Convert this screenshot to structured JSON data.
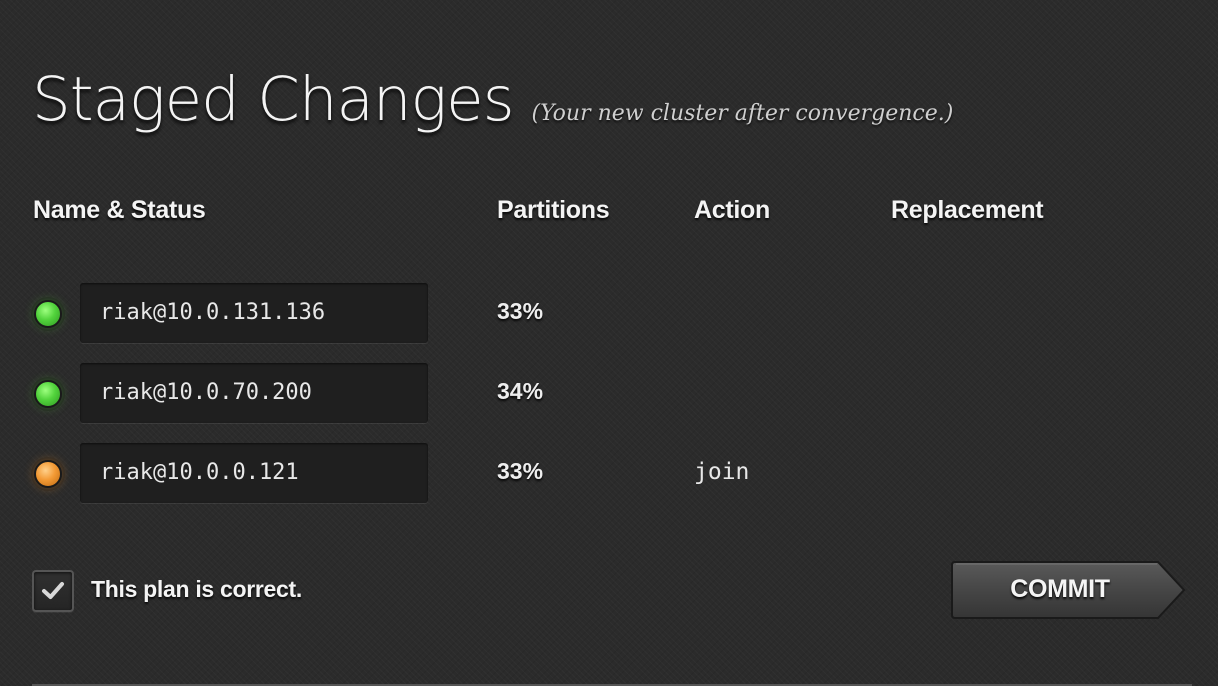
{
  "header": {
    "title": "Staged Changes",
    "subtitle": "(Your new cluster after convergence.)"
  },
  "columns": {
    "name_status": "Name & Status",
    "partitions": "Partitions",
    "action": "Action",
    "replacement": "Replacement"
  },
  "nodes": [
    {
      "name": "riak@10.0.131.136",
      "status": "valid",
      "status_color": "#52d33c",
      "partitions": "33%",
      "action": "",
      "replacement": ""
    },
    {
      "name": "riak@10.0.70.200",
      "status": "valid",
      "status_color": "#52d33c",
      "partitions": "34%",
      "action": "",
      "replacement": ""
    },
    {
      "name": "riak@10.0.0.121",
      "status": "joining",
      "status_color": "#f39a35",
      "partitions": "33%",
      "action": "join",
      "replacement": ""
    }
  ],
  "confirm": {
    "checked": true,
    "label": "This plan is correct.",
    "icon": "checkmark-icon"
  },
  "commit_button": {
    "label": "COMMIT"
  }
}
